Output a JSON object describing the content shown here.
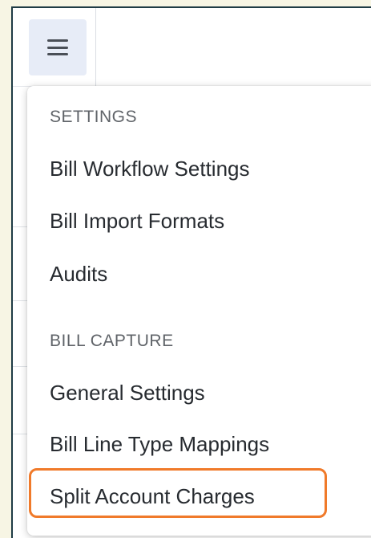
{
  "menu": {
    "sections": [
      {
        "header": "SETTINGS",
        "items": [
          "Bill Workflow Settings",
          "Bill Import Formats",
          "Audits"
        ]
      },
      {
        "header": "BILL CAPTURE",
        "items": [
          "General Settings",
          "Bill Line Type Mappings",
          "Split Account Charges"
        ]
      }
    ],
    "highlight_color": "#f07a2a"
  },
  "icons": {
    "menu_toggle": "hamburger-icon"
  }
}
